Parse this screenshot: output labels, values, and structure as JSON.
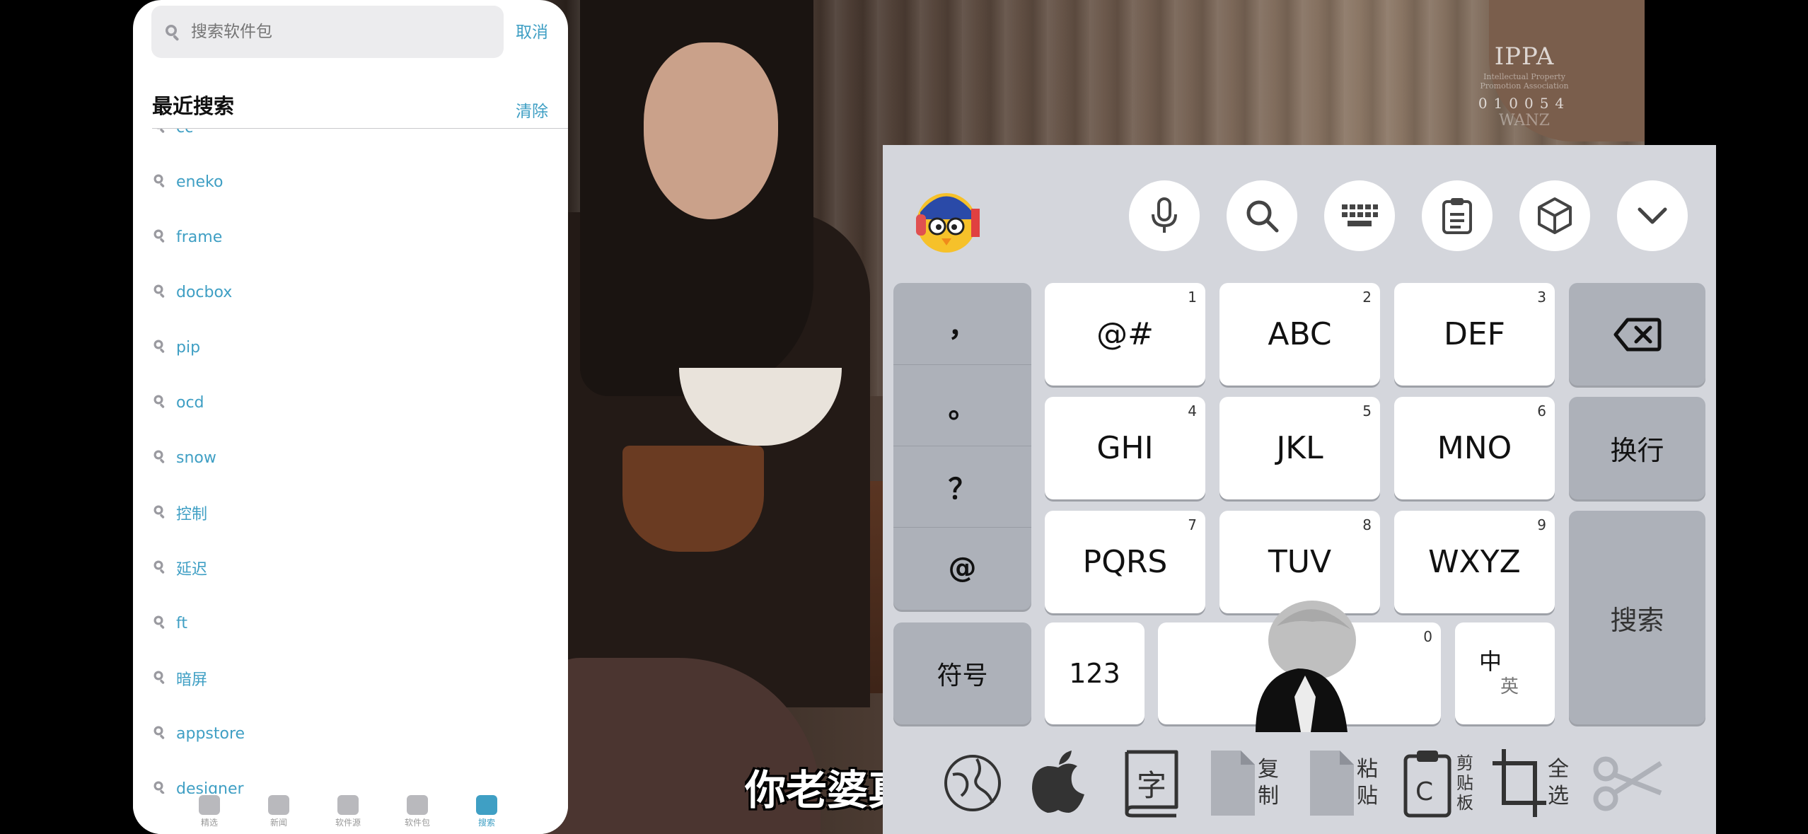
{
  "video": {
    "watermark_logo": "IPPA",
    "watermark_sub": "Intellectual Property Promotion Association",
    "watermark_number": "010054",
    "watermark_brand": "WANZ",
    "subtitle": "你老婆真"
  },
  "search_panel": {
    "search_placeholder": "搜索软件包",
    "cancel_label": "取消",
    "recent_title": "最近搜索",
    "clear_label": "清除",
    "recent_items": [
      "cc",
      "eneko",
      "frame",
      "docbox",
      "pip",
      "ocd",
      "snow",
      "控制",
      "延迟",
      "ft",
      "暗屏",
      "appstore",
      "designer"
    ],
    "tabs": [
      {
        "label": "精选",
        "icon": "star-icon"
      },
      {
        "label": "新闻",
        "icon": "download-icon"
      },
      {
        "label": "软件源",
        "icon": "sources-icon"
      },
      {
        "label": "软件包",
        "icon": "packages-icon"
      },
      {
        "label": "搜索",
        "icon": "search-icon",
        "active": true
      }
    ],
    "accent_color": "#3f9fc4"
  },
  "keyboard": {
    "top_buttons": [
      "microphone-icon",
      "search-icon",
      "keyboard-icon",
      "clipboard-icon",
      "cube-icon",
      "chevron-down-icon"
    ],
    "punctuation": [
      "，",
      "。",
      "？",
      "@"
    ],
    "keys": {
      "k1": {
        "label": "@#",
        "digit": "1"
      },
      "k2": {
        "label": "ABC",
        "digit": "2"
      },
      "k3": {
        "label": "DEF",
        "digit": "3"
      },
      "k4": {
        "label": "GHI",
        "digit": "4"
      },
      "k5": {
        "label": "JKL",
        "digit": "5"
      },
      "k6": {
        "label": "MNO",
        "digit": "6"
      },
      "k7": {
        "label": "PQRS",
        "digit": "7"
      },
      "k8": {
        "label": "TUV",
        "digit": "8"
      },
      "k9": {
        "label": "WXYZ",
        "digit": "9"
      },
      "space_digit": "0"
    },
    "enter_label": "换行",
    "search_label": "搜索",
    "symbols_label": "符号",
    "num_label": "123",
    "lang_zh": "中",
    "lang_en": "英",
    "toolbar": {
      "char_label": "字",
      "copy_label": "复制",
      "paste_label": "粘贴",
      "clipboard_label": "剪贴板",
      "select_all_label": "全选"
    }
  }
}
